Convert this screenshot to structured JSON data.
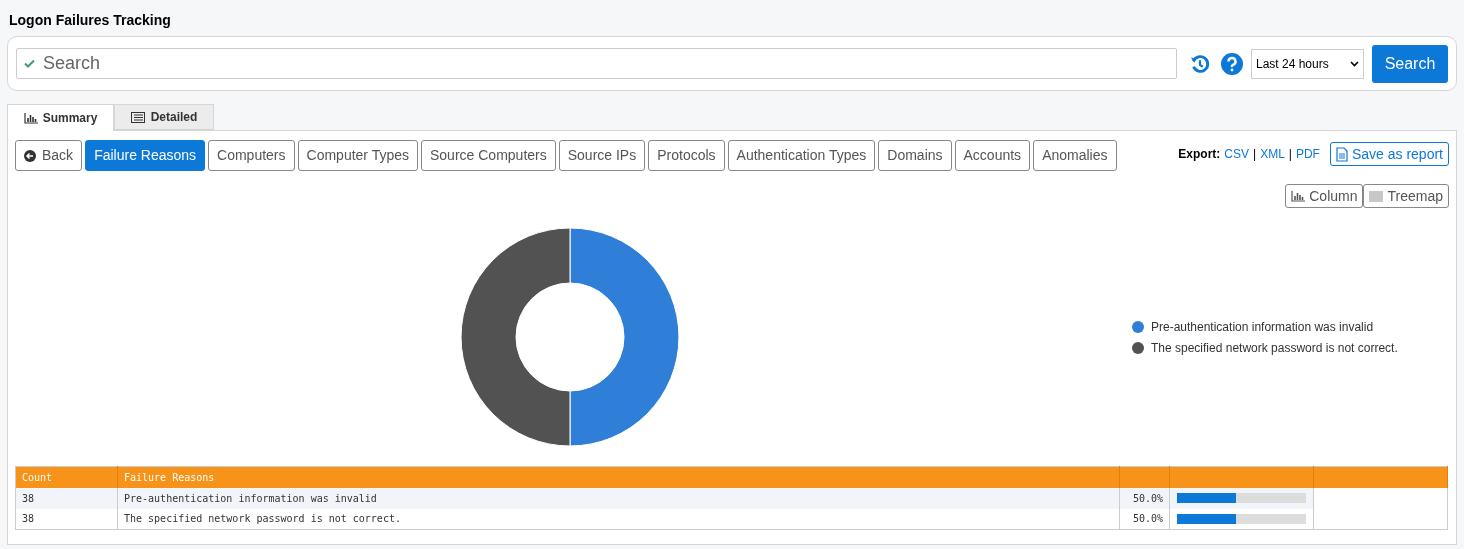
{
  "page_title": "Logon Failures Tracking",
  "search": {
    "placeholder": "Search",
    "valid": true,
    "period": "Last 24 hours",
    "button": "Search"
  },
  "tabs": [
    {
      "label": "Summary",
      "selected": true
    },
    {
      "label": "Detailed",
      "selected": false
    }
  ],
  "back_button": "Back",
  "report_buttons": [
    {
      "label": "Failure Reasons",
      "selected": true
    },
    {
      "label": "Computers",
      "selected": false
    },
    {
      "label": "Computer Types",
      "selected": false
    },
    {
      "label": "Source Computers",
      "selected": false
    },
    {
      "label": "Source IPs",
      "selected": false
    },
    {
      "label": "Protocols",
      "selected": false
    },
    {
      "label": "Authentication Types",
      "selected": false
    },
    {
      "label": "Domains",
      "selected": false
    },
    {
      "label": "Accounts",
      "selected": false
    },
    {
      "label": "Anomalies",
      "selected": false
    }
  ],
  "export": {
    "label": "Export:",
    "links": [
      "CSV",
      "XML",
      "PDF"
    ],
    "separators": [
      "|",
      "|"
    ]
  },
  "save_report": "Save as report",
  "chart_views": [
    {
      "label": "Column"
    },
    {
      "label": "Treemap"
    }
  ],
  "chart_data": {
    "type": "donut",
    "categories": [
      "Pre-authentication information was invalid",
      "The specified network password is not correct."
    ],
    "values": [
      50,
      50
    ],
    "colors": [
      "#2f7ed8",
      "#525252"
    ]
  },
  "table": {
    "columns": [
      "Count",
      "Failure Reasons"
    ],
    "rows": [
      {
        "count": "38",
        "reason": "Pre-authentication information was invalid",
        "percent": "50.0%",
        "level": 0.46
      },
      {
        "count": "38",
        "reason": "The specified network password is not correct.",
        "percent": "50.0%",
        "level": 0.46
      }
    ]
  }
}
